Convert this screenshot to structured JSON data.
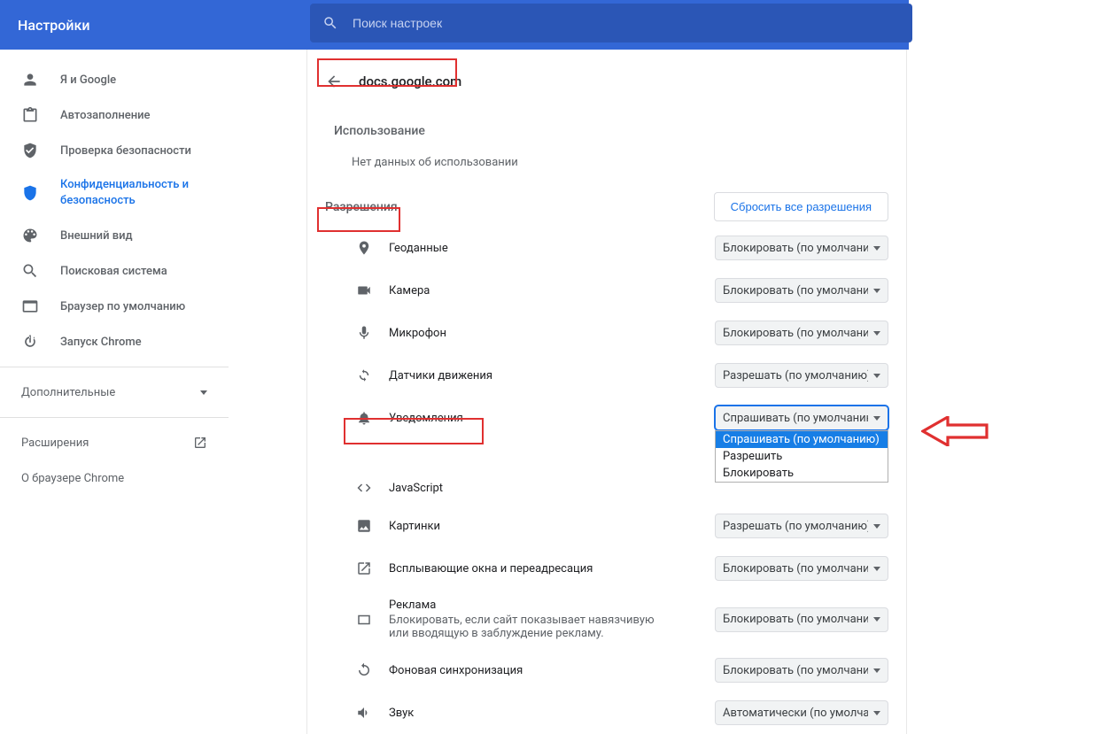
{
  "header": {
    "title": "Настройки",
    "search_placeholder": "Поиск настроек"
  },
  "sidebar": {
    "items": [
      {
        "label": "Я и Google"
      },
      {
        "label": "Автозаполнение"
      },
      {
        "label": "Проверка безопасности"
      },
      {
        "label": "Конфиденциальность и безопасность",
        "selected": true
      },
      {
        "label": "Внешний вид"
      },
      {
        "label": "Поисковая система"
      },
      {
        "label": "Браузер по умолчанию"
      },
      {
        "label": "Запуск Chrome"
      }
    ],
    "advanced": "Дополнительные",
    "extensions": "Расширения",
    "about": "О браузере Chrome"
  },
  "siteDetails": {
    "site": "docs.google.com",
    "usage_title": "Использование",
    "usage_text": "Нет данных об использовании",
    "perm_title": "Разрешения",
    "reset_btn": "Сбросить все разрешения",
    "permissions": [
      {
        "id": "location",
        "label": "Геоданные",
        "value": "Блокировать (по умолчанию)"
      },
      {
        "id": "camera",
        "label": "Камера",
        "value": "Блокировать (по умолчанию)"
      },
      {
        "id": "microphone",
        "label": "Микрофон",
        "value": "Блокировать (по умолчанию)"
      },
      {
        "id": "motion",
        "label": "Датчики движения",
        "value": "Разрешать (по умолчанию)"
      },
      {
        "id": "notifications",
        "label": "Уведомления",
        "value": "Спрашивать (по умолчанию)",
        "open": true,
        "options": [
          "Спрашивать (по умолчанию)",
          "Разрешить",
          "Блокировать"
        ]
      },
      {
        "id": "javascript",
        "label": "JavaScript",
        "value": ""
      },
      {
        "id": "images",
        "label": "Картинки",
        "value": "Разрешать (по умолчанию)"
      },
      {
        "id": "popups",
        "label": "Всплывающие окна и переадресация",
        "value": "Блокировать (по умолчанию)"
      },
      {
        "id": "ads",
        "label": "Реклама",
        "sub": "Блокировать, если сайт показывает навязчивую или вводящую в заблуждение рекламу.",
        "value": "Блокировать (по умолчанию)"
      },
      {
        "id": "sync",
        "label": "Фоновая синхронизация",
        "value": "Блокировать (по умолчанию)"
      },
      {
        "id": "sound",
        "label": "Звук",
        "value": "Автоматически (по умолчанию)"
      }
    ]
  }
}
